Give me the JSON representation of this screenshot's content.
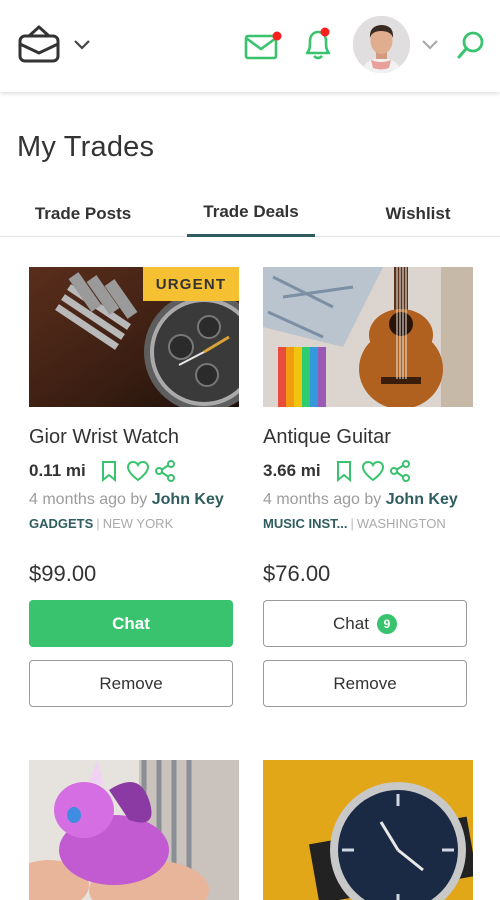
{
  "header": {
    "logo_icon": "shopping-bag-icon",
    "mail_icon": "mail-icon",
    "bell_icon": "bell-icon",
    "search_icon": "search-icon",
    "brand_color": "#39c36e",
    "notification_dot_color": "#ff1e1e"
  },
  "page": {
    "title": "My Trades"
  },
  "tabs": [
    {
      "label": "Trade Posts"
    },
    {
      "label": "Trade Deals",
      "active": true
    },
    {
      "label": "Wishlist"
    }
  ],
  "cards": [
    {
      "badge": "URGENT",
      "name": "Gior Wrist Watch",
      "distance": "0.11 mi",
      "posted_prefix": "4 months ago by",
      "author": "John Key",
      "category": "GADGETS",
      "separator": "|",
      "location": "NEW YORK",
      "price": "$99.00",
      "chat_label": "Chat",
      "remove_label": "Remove"
    },
    {
      "name": "Antique Guitar",
      "distance": "3.66 mi",
      "posted_prefix": "4 months ago by",
      "author": "John Key",
      "category": "MUSIC INST...",
      "separator": "|",
      "location": "WASHINGTON",
      "price": "$76.00",
      "chat_label": "Chat",
      "chat_count": "9",
      "remove_label": "Remove"
    }
  ]
}
